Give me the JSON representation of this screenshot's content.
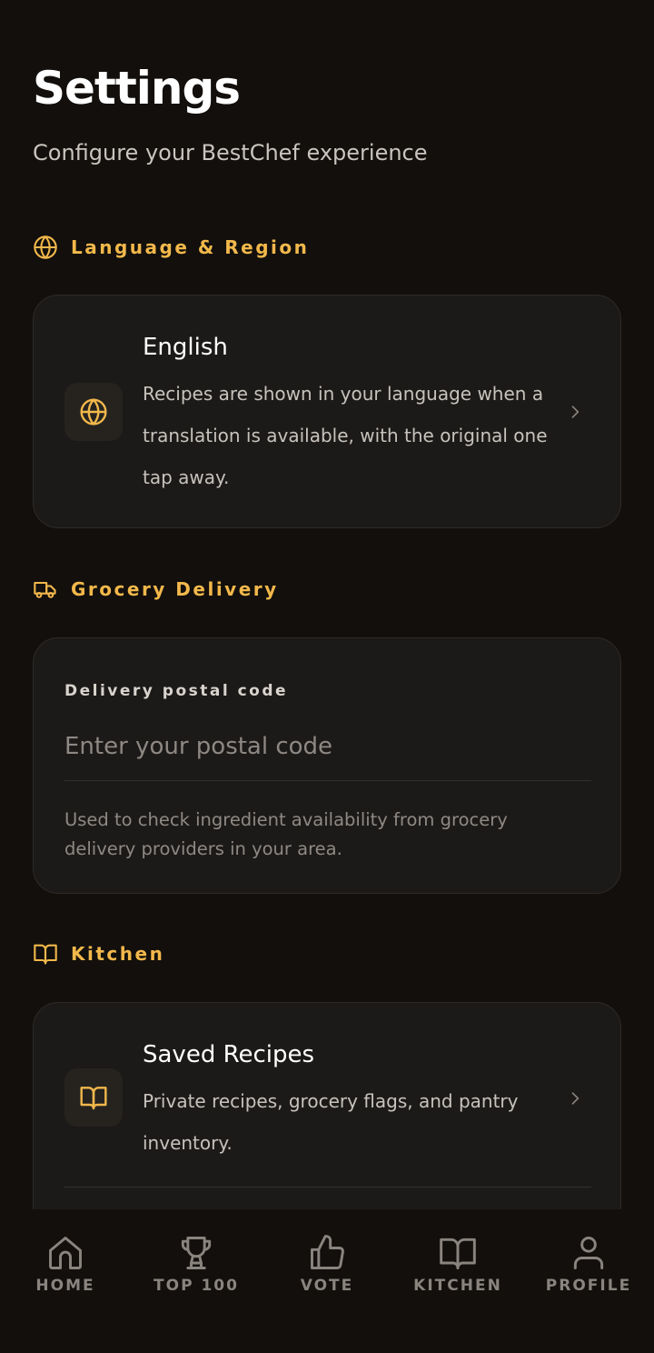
{
  "header": {
    "title": "Settings",
    "subtitle": "Configure your BestChef experience"
  },
  "sections": {
    "language": {
      "label": "Language & Region",
      "icon": "globe-icon",
      "row": {
        "title": "English",
        "description": "Recipes are shown in your language when a translation is available, with the original one tap away."
      }
    },
    "grocery": {
      "label": "Grocery Delivery",
      "icon": "truck-icon",
      "field_label": "Delivery postal code",
      "value": "",
      "placeholder": "Enter your postal code",
      "hint": "Used to check ingredient availability from grocery delivery providers in your area."
    },
    "kitchen": {
      "label": "Kitchen",
      "icon": "book-icon",
      "row": {
        "title": "Saved Recipes",
        "description": "Private recipes, grocery flags, and pantry inventory."
      }
    }
  },
  "nav": {
    "items": [
      {
        "label": "HOME",
        "icon": "home-icon"
      },
      {
        "label": "TOP 100",
        "icon": "trophy-icon"
      },
      {
        "label": "VOTE",
        "icon": "thumbs-up-icon"
      },
      {
        "label": "KITCHEN",
        "icon": "book-icon"
      },
      {
        "label": "PROFILE",
        "icon": "user-icon"
      }
    ]
  },
  "colors": {
    "background": "#120f0c",
    "card": "#1c1a18",
    "accent": "#f2b84b",
    "muted": "#8a847f"
  }
}
